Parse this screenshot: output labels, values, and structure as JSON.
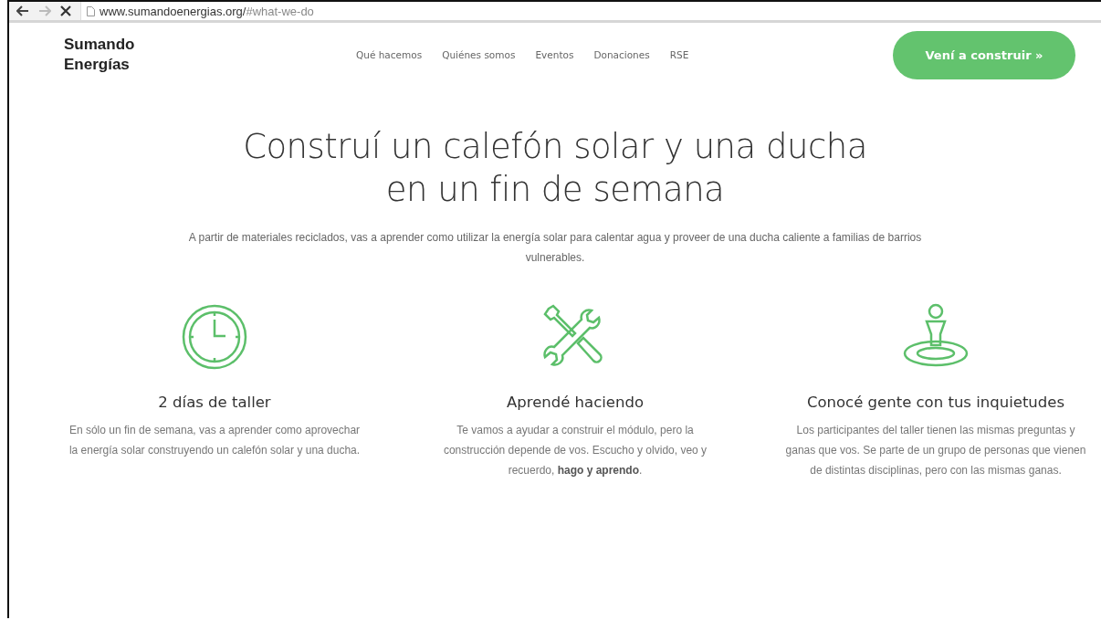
{
  "browser": {
    "url_host": "www.sumandoenergias.org/",
    "url_path": "#what-we-do"
  },
  "logo": [
    "Sumando",
    "Energías"
  ],
  "nav": [
    {
      "label": "Qué hacemos"
    },
    {
      "label": "Quiénes somos"
    },
    {
      "label": "Eventos"
    },
    {
      "label": "Donaciones"
    },
    {
      "label": "RSE"
    }
  ],
  "cta_button": "Vení a construir »",
  "hero": {
    "title_lines": [
      "Construí un calefón solar y una ducha",
      "en un fin de semana"
    ],
    "lead": "A partir de materiales reciclados, vas a aprender como utilizar la energía solar para calentar agua y proveer de una ducha caliente a familias de barrios vulnerables."
  },
  "features": [
    {
      "kind": "clock",
      "title": "2 días de taller",
      "text": "En sólo un fin de semana, vas a aprender como aprovechar la energía solar construyendo un calefón solar y una ducha."
    },
    {
      "kind": "tools",
      "title": "Aprendé haciendo",
      "text": "Te vamos a ayudar a construir el módulo, pero la construcción depende de vos. Escucho y olvido, veo y recuerdo, **hago y aprendo**."
    },
    {
      "kind": "person",
      "title": "Conocé gente con tus inquietudes",
      "text": "Los participantes del taller tienen las mismas preguntas y ganas que vos. Se parte de un grupo de personas que vienen de distintas disciplinas, pero con las mismas ganas."
    }
  ]
}
